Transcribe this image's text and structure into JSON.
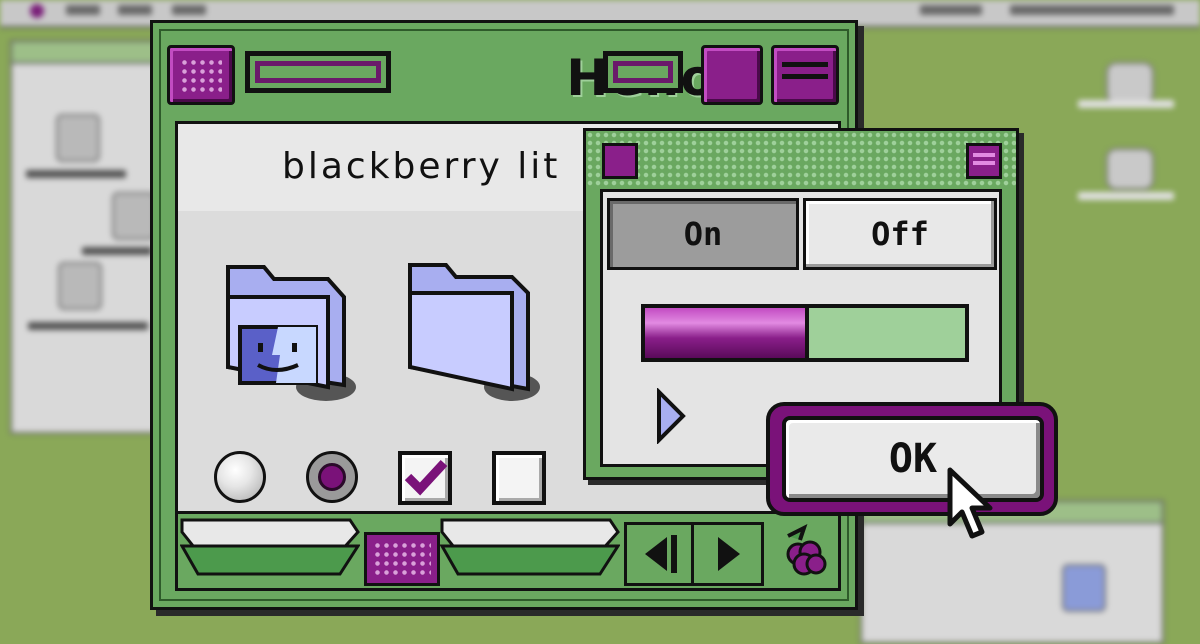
{
  "window": {
    "title": "Hello!",
    "header_text": "blackberry lit"
  },
  "palette": {
    "segment_on": "On",
    "segment_off": "Off",
    "progress": 0.5
  },
  "dialog": {
    "ok_label": "OK"
  },
  "controls": {
    "radio_1_selected": false,
    "radio_2_selected": true,
    "checkbox_1_checked": true,
    "checkbox_2_checked": false
  },
  "colors": {
    "accent_purple": "#8a1f8a",
    "window_green": "#6aa860",
    "light_green": "#9fd09a",
    "desktop_green": "#8aa858"
  },
  "icons": [
    "finder-folder-icon",
    "folder-icon",
    "disclosure-triangle-icon",
    "blackberry-icon",
    "left-arrow-icon",
    "right-arrow-icon",
    "pointer-cursor-icon"
  ]
}
